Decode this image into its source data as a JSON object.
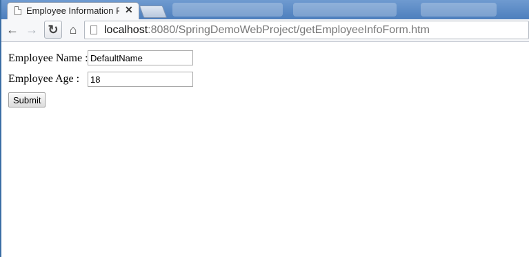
{
  "browser": {
    "tab_title": "Employee Information F",
    "url_host": "localhost",
    "url_rest": ":8080/SpringDemoWebProject/getEmployeeInfoForm.htm"
  },
  "form": {
    "name_label": "Employee Name :",
    "name_value": "DefaultName",
    "age_label": "Employee Age :",
    "age_value": "18",
    "submit_label": "Submit"
  },
  "icons": {
    "back": "back-arrow-icon",
    "forward": "forward-arrow-icon",
    "reload": "reload-icon",
    "home": "home-icon",
    "page": "page-icon",
    "close": "close-icon"
  }
}
